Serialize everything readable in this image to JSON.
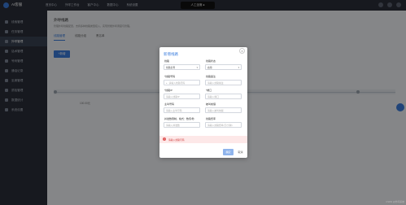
{
  "topbar": {
    "brand": "AI客服",
    "nav": [
      "首页中心",
      "外呼工作台",
      "客户中心",
      "数据中心",
      "系统设置"
    ],
    "phone_label": "人工坐席 ●"
  },
  "sidebar": {
    "items": [
      {
        "label": "线索管理",
        "active": false
      },
      {
        "label": "任务管理",
        "active": false
      },
      {
        "label": "外呼管理",
        "active": true
      },
      {
        "label": "话术管理",
        "active": false
      },
      {
        "label": "号码管理",
        "active": false
      },
      {
        "label": "通话记录",
        "active": false
      },
      {
        "label": "坐席管理",
        "active": false
      },
      {
        "label": "质检管理",
        "active": false
      },
      {
        "label": "数据统计",
        "active": false
      },
      {
        "label": "系统设置",
        "active": false
      }
    ]
  },
  "main": {
    "title": "外呼线路",
    "desc": "管理外呼线路配置，支持多种线路类型接入，实现智能外呼调度与管理。",
    "tabs": [
      {
        "label": "线路管理",
        "active": true
      },
      {
        "label": "线路分组",
        "active": false
      },
      {
        "label": "黑名单",
        "active": false
      }
    ],
    "add_button": "+新增",
    "col_text": "100.00元"
  },
  "modal": {
    "title": "新增线路",
    "close": "×",
    "fields": [
      {
        "label": "线路",
        "value": "线路名称",
        "filled": true,
        "select": true
      },
      {
        "label": "线路状态",
        "value": "启用",
        "filled": true,
        "select": true
      },
      {
        "label": "*线路号码",
        "value": "请输入线路号码",
        "prefix": "+",
        "filled": false
      },
      {
        "label": "线路备注",
        "value": "请输入线路备注",
        "filled": false
      },
      {
        "label": "*线路IP",
        "value": "请输入线路IP",
        "filled": false
      },
      {
        "label": "*端口",
        "value": "请输入端口",
        "filled": false
      },
      {
        "label": "主叫号码",
        "value": "请输入主叫号码",
        "filled": false
      },
      {
        "label": "被叫前缀",
        "value": "请输入被叫前缀",
        "filled": false
      },
      {
        "label": "并发数限制，格式：数值/秒",
        "value": "请输入并发数",
        "filled": false
      },
      {
        "label": "线路费率",
        "value": "请输入线路费率(元/分钟)",
        "filled": false
      }
    ],
    "error": "请输入线路号码",
    "confirm": "确定",
    "cancel": "取消"
  },
  "footer": "CSDN @外呼系统"
}
